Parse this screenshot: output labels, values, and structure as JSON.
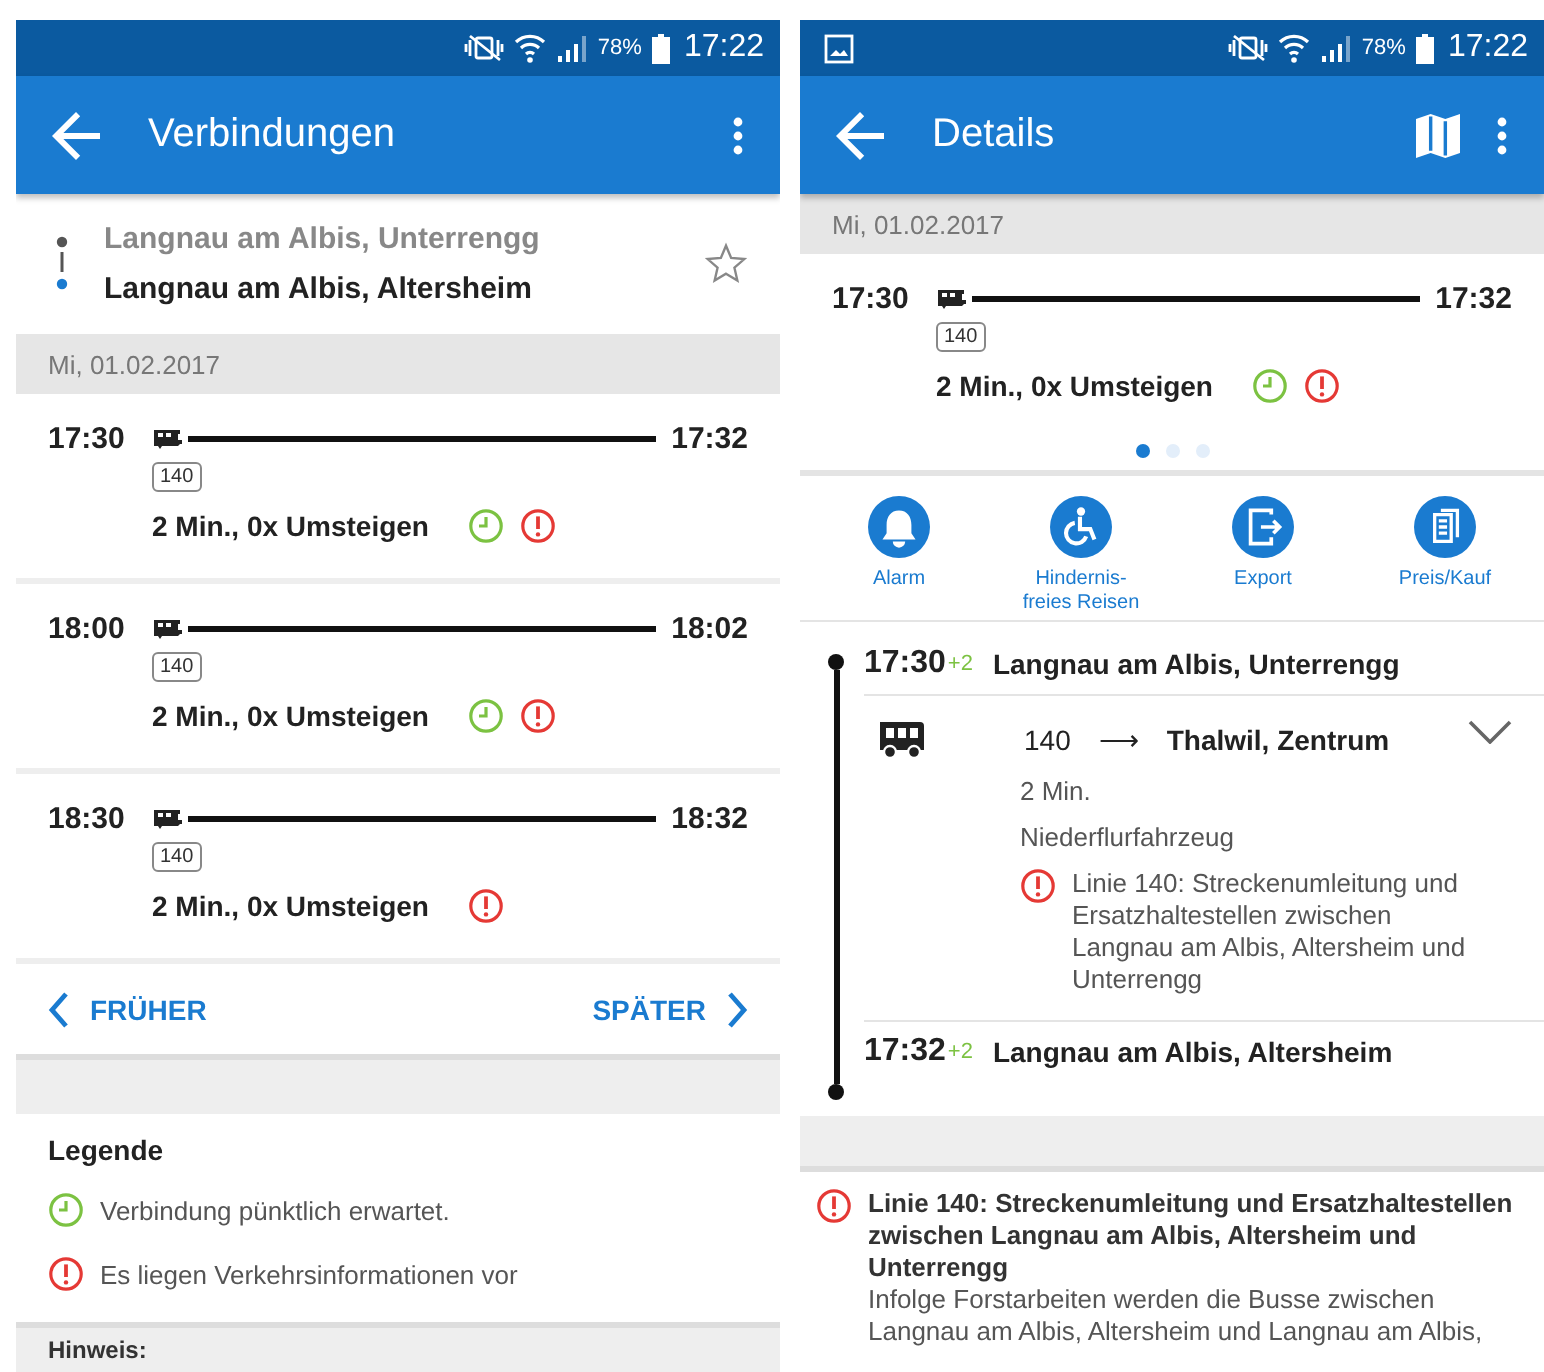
{
  "connections_screen": {
    "status_bar": {
      "battery": "78%",
      "time": "17:22"
    },
    "app_bar": {
      "title": "Verbindungen"
    },
    "route": {
      "from": "Langnau am Albis, Unterrengg",
      "to": "Langnau am Albis, Altersheim",
      "favorite": false
    },
    "date": "Mi, 01.02.2017",
    "connections": [
      {
        "departure": "17:30",
        "arrival": "17:32",
        "line": "140",
        "summary": "2 Min., 0x Umsteigen",
        "on_time": true,
        "info": true
      },
      {
        "departure": "18:00",
        "arrival": "18:02",
        "line": "140",
        "summary": "2 Min., 0x Umsteigen",
        "on_time": true,
        "info": true
      },
      {
        "departure": "18:30",
        "arrival": "18:32",
        "line": "140",
        "summary": "2 Min., 0x Umsteigen",
        "on_time": false,
        "info": true
      }
    ],
    "paging": {
      "earlier": "FRÜHER",
      "later": "SPÄTER"
    },
    "legend": {
      "title": "Legende",
      "items": [
        {
          "kind": "on_time",
          "text": "Verbindung pünktlich erwartet."
        },
        {
          "kind": "info",
          "text": "Es liegen Verkehrsinformationen vor"
        }
      ]
    },
    "note": {
      "title": "Hinweis:"
    }
  },
  "details_screen": {
    "status_bar": {
      "battery": "78%",
      "time": "17:22"
    },
    "app_bar": {
      "title": "Details"
    },
    "date": "Mi, 01.02.2017",
    "connection": {
      "departure": "17:30",
      "arrival": "17:32",
      "line": "140",
      "summary": "2 Min., 0x Umsteigen",
      "on_time": true,
      "info": true
    },
    "page_dots": [
      {
        "selected": true
      },
      {
        "selected": false
      },
      {
        "selected": false
      }
    ],
    "actions": [
      {
        "kind": "alarm",
        "label": "Alarm"
      },
      {
        "kind": "accessible",
        "label": "Hindernis-freies Reisen"
      },
      {
        "kind": "export",
        "label": "Export"
      },
      {
        "kind": "price",
        "label": "Preis/Kauf"
      }
    ],
    "journey": {
      "start": {
        "time": "17:30",
        "delay": "+2",
        "stop": "Langnau am Albis, Unterrengg"
      },
      "leg": {
        "line": "140",
        "arrow": "⟶",
        "direction": "Thalwil, Zentrum",
        "duration": "2 Min.",
        "vehicle": "Niederflurfahrzeug",
        "info": "Linie 140: Streckenumleitung und Ersatzhaltestellen zwischen Langnau am Albis, Altersheim und Unterrengg",
        "expanded": false
      },
      "end": {
        "time": "17:32",
        "delay": "+2",
        "stop": "Langnau am Albis, Altersheim"
      }
    },
    "notice": {
      "title": "Linie 140: Streckenumleitung und Ersatzhaltestellen zwischen Langnau am Albis, Altersheim und Unterrengg",
      "body": "Infolge Forstarbeiten werden die Busse zwischen Langnau am Albis, Altersheim und Langnau am Albis,"
    }
  }
}
